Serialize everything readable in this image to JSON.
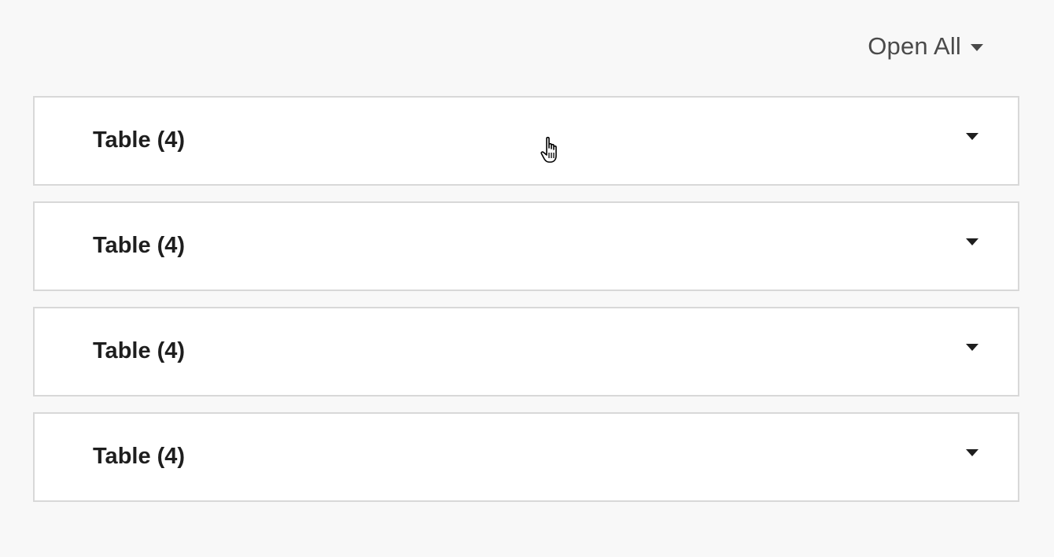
{
  "toolbar": {
    "open_all_label": "Open All"
  },
  "accordion": {
    "items": [
      {
        "label": "Table (4)"
      },
      {
        "label": "Table (4)"
      },
      {
        "label": "Table (4)"
      },
      {
        "label": "Table (4)"
      }
    ]
  },
  "icons": {
    "caret": "chevron-down-icon",
    "cursor": "hand-pointer-icon"
  },
  "colors": {
    "background": "#f8f8f8",
    "panel": "#ffffff",
    "border": "#d8d8d8",
    "text": "#1e1e1e",
    "muted_text": "#4a4a4a"
  }
}
